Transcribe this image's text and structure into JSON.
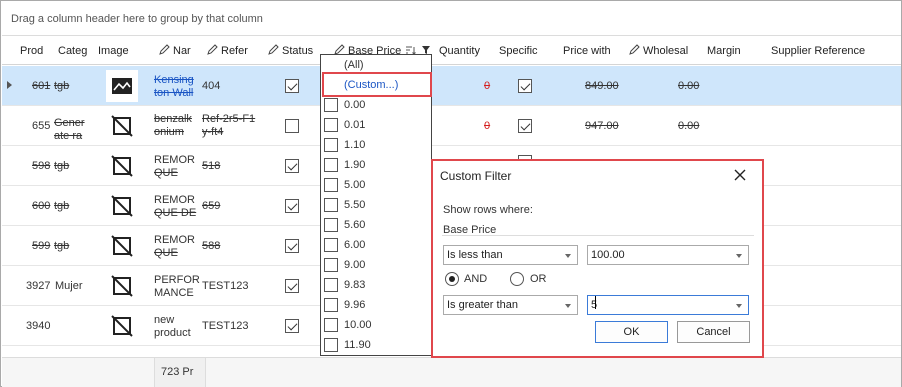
{
  "group_panel": {
    "hint": "Drag a column header here to group by that column"
  },
  "columns": [
    {
      "label": "Prod",
      "editable": false
    },
    {
      "label": "Categ",
      "editable": false
    },
    {
      "label": "Image",
      "editable": false
    },
    {
      "label": "Nar",
      "editable": true
    },
    {
      "label": "Refer",
      "editable": true
    },
    {
      "label": "Status",
      "editable": true
    },
    {
      "label": "Base Price",
      "editable": true
    },
    {
      "label": "Quantity",
      "editable": false
    },
    {
      "label": "Specific",
      "editable": false
    },
    {
      "label": "Price with",
      "editable": false
    },
    {
      "label": "Wholesal",
      "editable": true
    },
    {
      "label": "Margin",
      "editable": false
    },
    {
      "label": "Supplier Reference",
      "editable": false
    }
  ],
  "rows": [
    {
      "prod": "601",
      "categ": "tgb",
      "name": [
        "Kensing",
        "ton Wall"
      ],
      "ref": "404",
      "status": true,
      "qty": "0",
      "specific": true,
      "price_with": "849.00",
      "wholesale": "0.00",
      "selected": true,
      "has_image": true
    },
    {
      "prod": "655",
      "categ": [
        "Gener",
        "ate ra"
      ],
      "name": [
        "benzalk",
        "onium"
      ],
      "ref": [
        "Ref-2r5-F1",
        "y-ft4"
      ],
      "status": false,
      "qty": "0",
      "specific": true,
      "price_with": "947.00",
      "wholesale": "0.00"
    },
    {
      "prod": "598",
      "categ": "tgb",
      "name": [
        "REMOR",
        "QUE"
      ],
      "ref": "518",
      "status": true
    },
    {
      "prod": "600",
      "categ": "tgb",
      "name": [
        "REMOR",
        "QUE DE"
      ],
      "ref": "659",
      "status": true
    },
    {
      "prod": "599",
      "categ": "tgb",
      "name": [
        "REMOR",
        "QUE"
      ],
      "ref": "588",
      "status": true
    },
    {
      "prod": "3927",
      "categ": "Mujer",
      "name": [
        "PERFOR",
        "MANCE"
      ],
      "ref": "TEST123",
      "status": true
    },
    {
      "prod": "3940",
      "categ": "",
      "name": [
        "new",
        "product"
      ],
      "ref": "TEST123",
      "status": true
    }
  ],
  "footer": {
    "count_text": "723 Pr"
  },
  "filter_dropdown": {
    "items": [
      "(All)",
      "(Custom...)",
      "0.00",
      "0.01",
      "1.10",
      "1.90",
      "5.00",
      "5.50",
      "5.60",
      "6.00",
      "9.00",
      "9.83",
      "9.96",
      "10.00",
      "11.90"
    ]
  },
  "dialog": {
    "title": "Custom Filter",
    "show_rows_where": "Show rows where:",
    "field": "Base Price",
    "condition1": {
      "operator": "Is less than",
      "value": "100.00"
    },
    "logic_and": "AND",
    "logic_or": "OR",
    "logic_selected": "AND",
    "condition2": {
      "operator": "Is greater than",
      "value": "5"
    },
    "ok_label": "OK",
    "cancel_label": "Cancel"
  },
  "colors": {
    "selected_row": "#cfe6fb",
    "highlight": "#e0474c",
    "strike_red": "#d42020"
  }
}
